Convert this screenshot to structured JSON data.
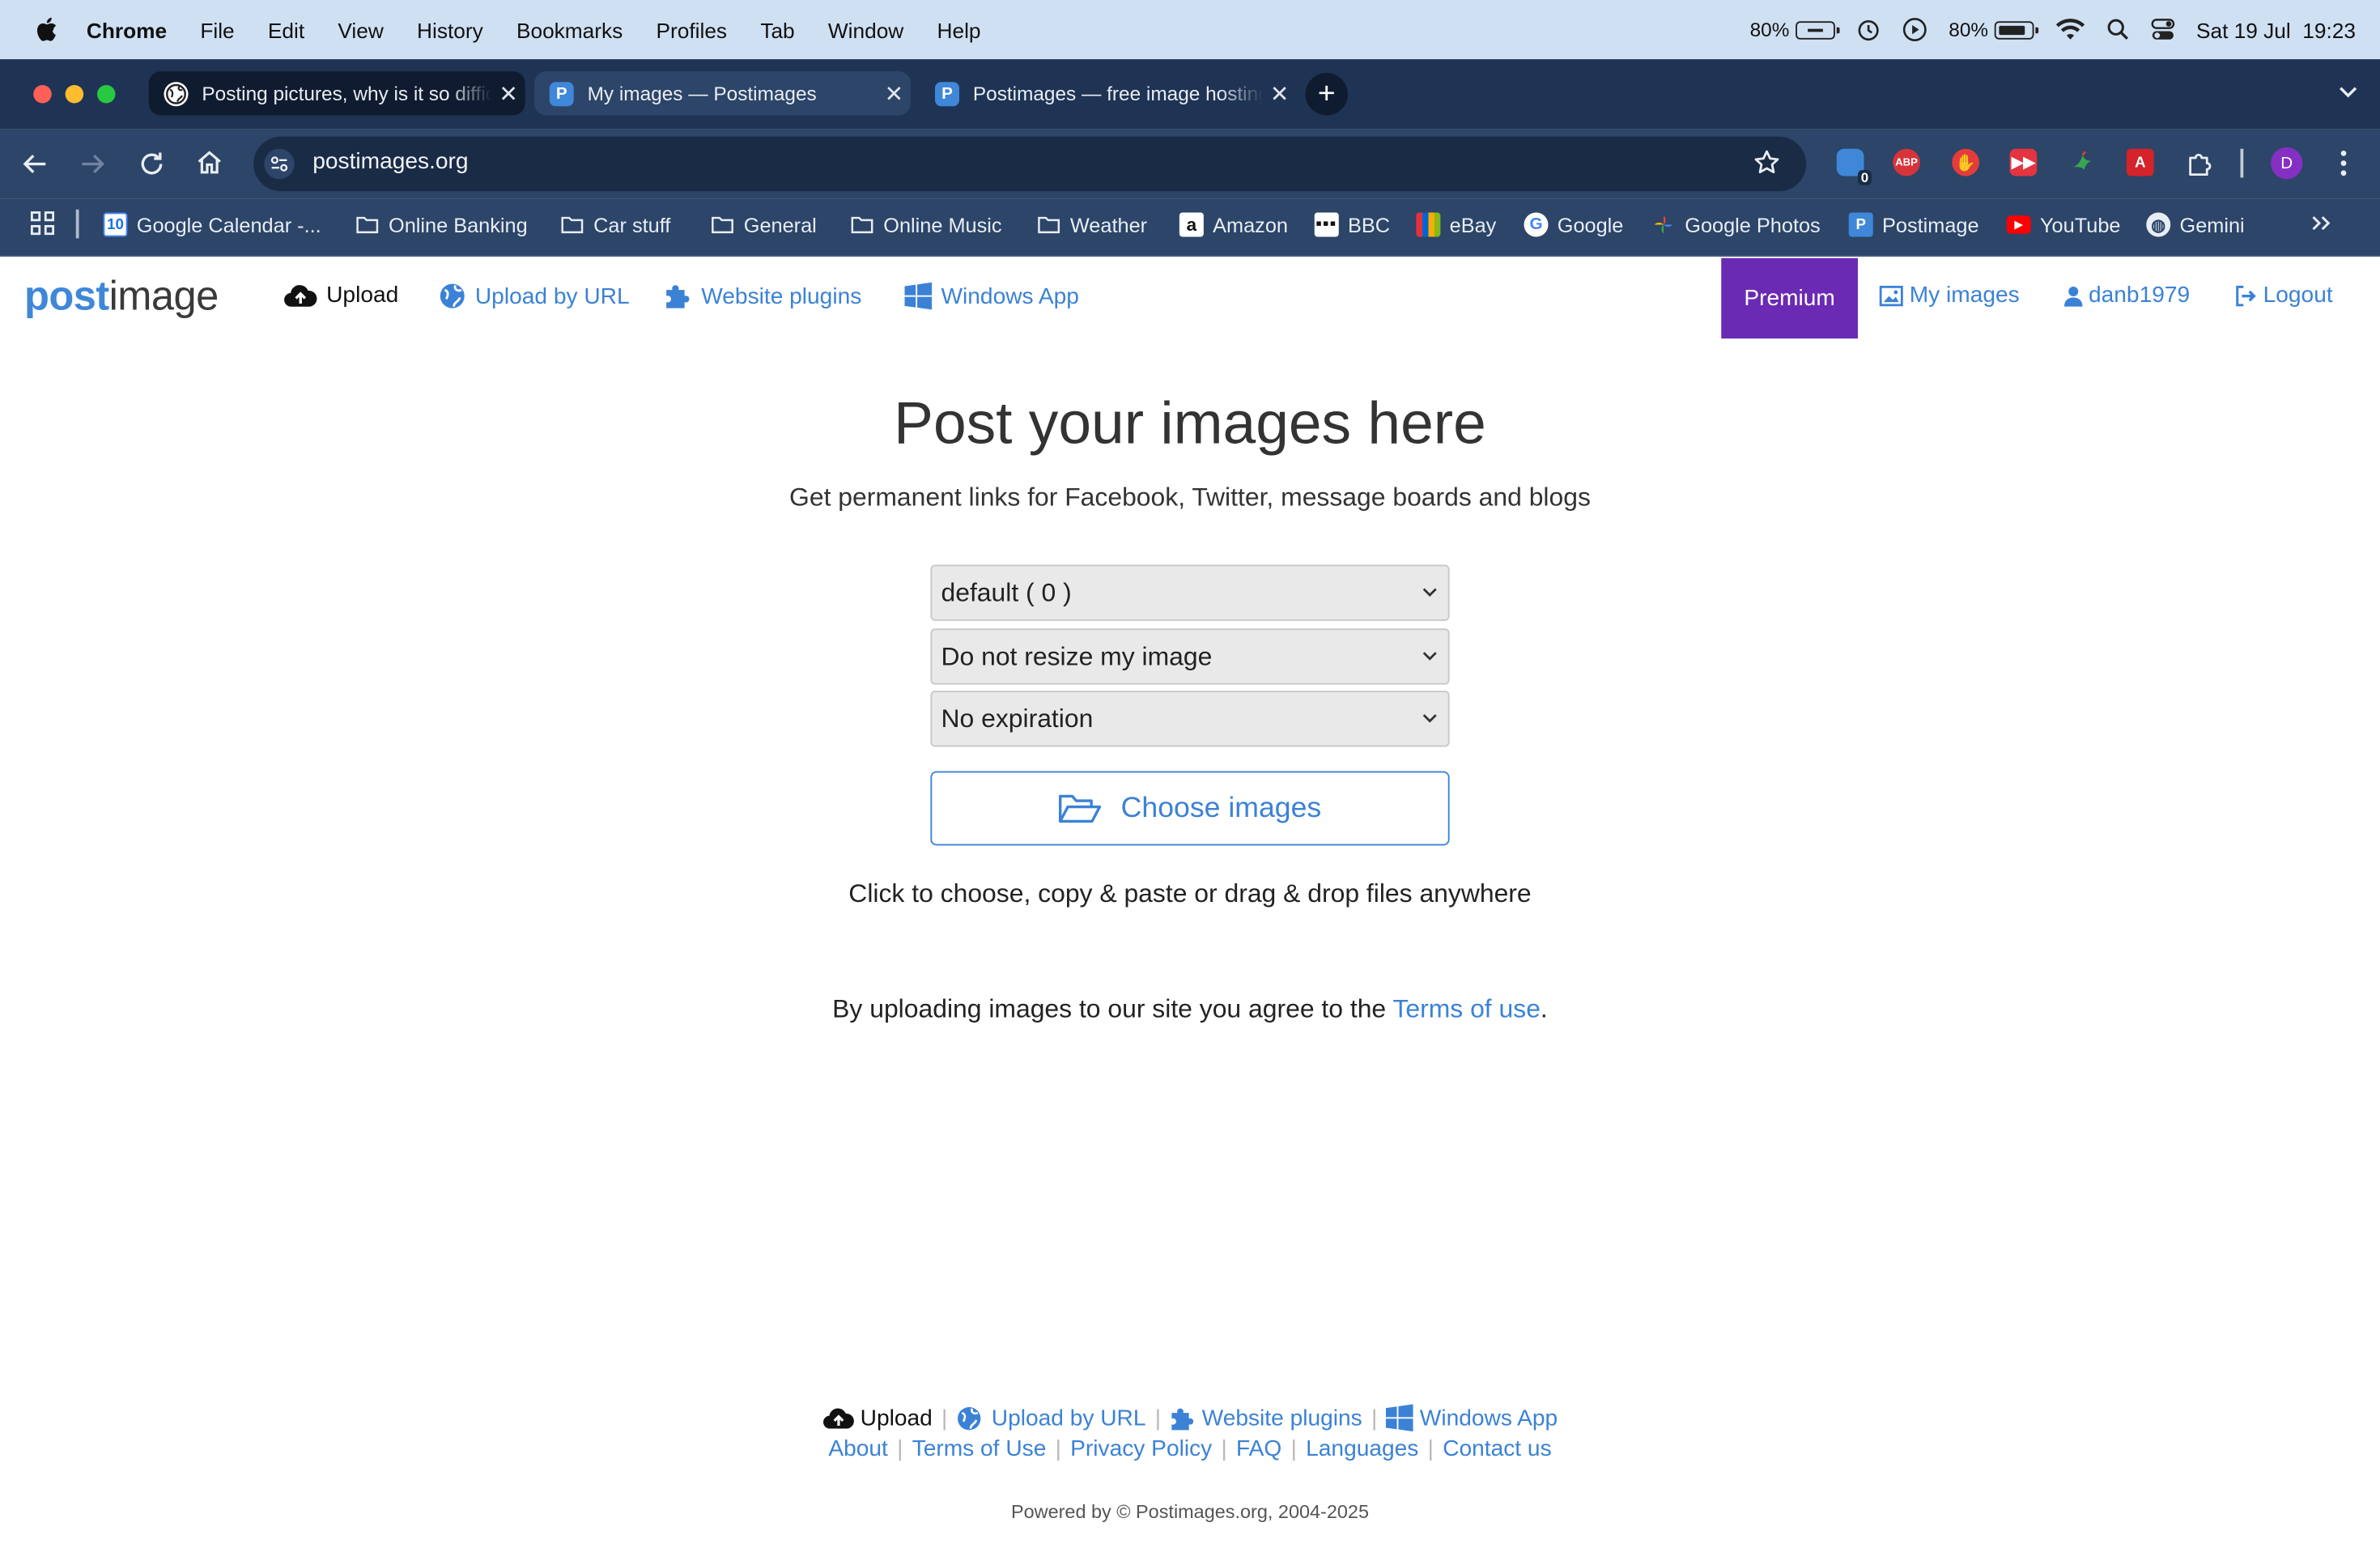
{
  "menubar": {
    "app": "Chrome",
    "items": [
      "File",
      "Edit",
      "View",
      "History",
      "Bookmarks",
      "Profiles",
      "Tab",
      "Window",
      "Help"
    ],
    "status": {
      "battery_left": "80%",
      "battery_right": "80%",
      "datetime": "Sat 19 Jul  19:23"
    }
  },
  "browser": {
    "tabs": [
      {
        "title": "Posting pictures, why is it so difficult",
        "active": true
      },
      {
        "title": "My images — Postimages",
        "active": false
      },
      {
        "title": "Postimages — free image hosting",
        "active": false
      }
    ],
    "url": "postimages.org",
    "bookmarks": [
      "Google Calendar -...",
      "Online Banking",
      "Car stuff",
      "General",
      "Online Music",
      "Weather",
      "Amazon",
      "BBC",
      "eBay",
      "Google",
      "Google Photos",
      "Postimage",
      "YouTube",
      "Gemini"
    ],
    "profile_initial": "D",
    "badge_count": "0"
  },
  "site": {
    "logo_light": "post",
    "logo_dark": "image",
    "nav": {
      "upload": "Upload",
      "upload_url": "Upload by URL",
      "plugins": "Website plugins",
      "windows_app": "Windows App",
      "premium": "Premium",
      "my_images": "My images",
      "username": "danb1979",
      "logout": "Logout"
    },
    "hero": {
      "title": "Post your images here",
      "subtitle": "Get permanent links for Facebook, Twitter, message boards and blogs"
    },
    "form": {
      "gallery": "default ( 0 )",
      "resize": "Do not resize my image",
      "expiration": "No expiration",
      "choose": "Choose images",
      "hint": "Click to choose, copy & paste or drag & drop files anywhere"
    },
    "terms": {
      "prefix": "By uploading images to our site you agree to the",
      "link": "Terms of use",
      "suffix": "."
    },
    "footer": {
      "row1": [
        "Upload",
        "Upload by URL",
        "Website plugins",
        "Windows App"
      ],
      "row2": [
        "About",
        "Terms of Use",
        "Privacy Policy",
        "FAQ",
        "Languages",
        "Contact us"
      ],
      "powered": "Powered by © Postimages.org, 2004-2025"
    }
  },
  "colors": {
    "accent": "#3b82d6",
    "premium": "#6a2ab4",
    "chrome_frame": "#2c4568",
    "menubar": "#cfe0f3"
  }
}
